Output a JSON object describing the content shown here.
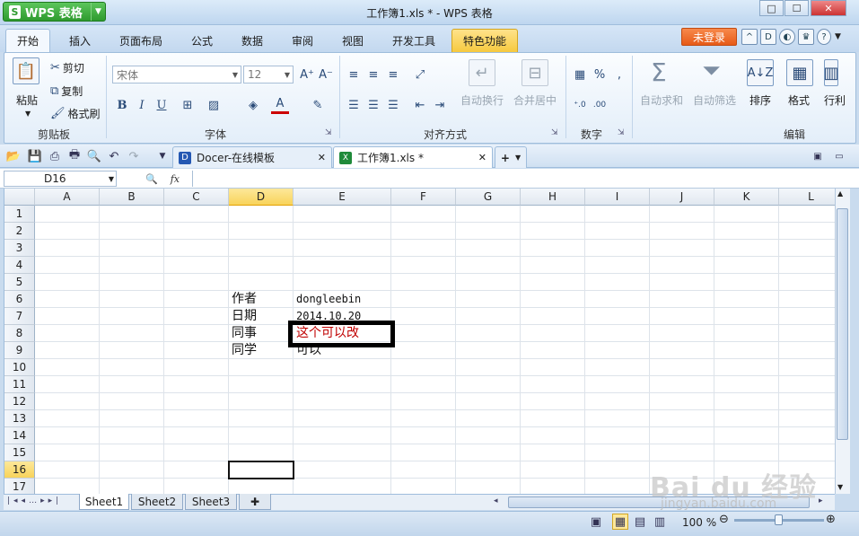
{
  "window": {
    "app_label": "WPS 表格",
    "app_logo": "S",
    "title": "工作簿1.xls * - WPS 表格",
    "controls": [
      "□",
      "☐",
      "✕"
    ]
  },
  "menu_tabs": [
    "开始",
    "插入",
    "页面布局",
    "公式",
    "数据",
    "审阅",
    "视图",
    "开发工具",
    "特色功能"
  ],
  "account": {
    "login_label": "未登录"
  },
  "ribbon": {
    "clipboard": {
      "paste": "粘贴",
      "cut": "剪切",
      "copy": "复制",
      "format_painter": "格式刷",
      "group": "剪贴板"
    },
    "font": {
      "name": "宋体",
      "size": "12",
      "bold": "B",
      "italic": "I",
      "underline": "U",
      "group": "字体"
    },
    "align": {
      "wrap": "自动换行",
      "merge": "合并居中",
      "group": "对齐方式"
    },
    "number": {
      "percent": "%",
      "group": "数字"
    },
    "edit": {
      "autosum": "自动求和",
      "autofilter": "自动筛选",
      "sort": "排序",
      "format": "格式",
      "row_col": "行利",
      "group": "编辑"
    }
  },
  "doc_tabs": [
    {
      "label": "Docer-在线模板",
      "close": "✕"
    },
    {
      "label": "工作簿1.xls *",
      "close": "✕"
    }
  ],
  "formula_bar": {
    "name_box": "D16",
    "fx": "fx",
    "value": ""
  },
  "columns": [
    "A",
    "B",
    "C",
    "D",
    "E",
    "F",
    "G",
    "H",
    "I",
    "J",
    "K",
    "L"
  ],
  "rows": [
    "1",
    "2",
    "3",
    "4",
    "5",
    "6",
    "7",
    "8",
    "9",
    "10",
    "11",
    "12",
    "13",
    "14",
    "15",
    "16",
    "17"
  ],
  "selected_cell": "D16",
  "cells": {
    "D6": "作者",
    "E6": "dongleebin",
    "D7": "日期",
    "E7": "2014.10.20",
    "D8": "同事",
    "E8": "这个可以改",
    "D9": "同学",
    "E9": "可以"
  },
  "sheets": [
    "Sheet1",
    "Sheet2",
    "Sheet3"
  ],
  "status": {
    "zoom": "100 %"
  },
  "watermark": {
    "brand": "Bai du 经验",
    "url": "jingyan.baidu.com"
  },
  "colors": {
    "accent": "#2e9a2e",
    "login": "#e75a17",
    "special_tab": "#f6c93f",
    "highlight_text": "#c00000"
  }
}
